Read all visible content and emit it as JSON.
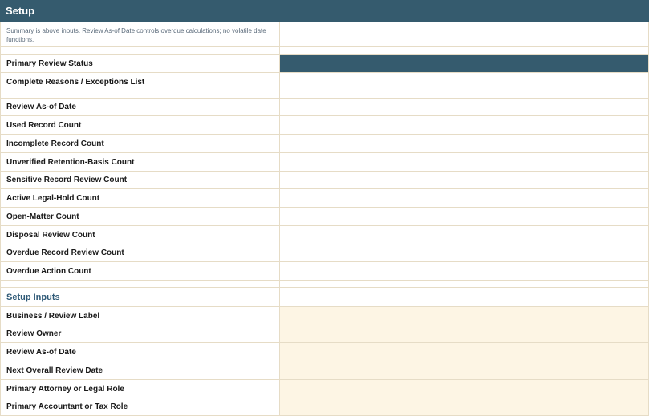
{
  "title": "Setup",
  "note": "Summary is above inputs. Review As-of Date controls overdue calculations; no volatile date functions.",
  "summary": {
    "primary_status": "Primary Review Status",
    "reasons": "Complete Reasons / Exceptions List",
    "as_of": "Review As-of Date",
    "used": "Used Record Count",
    "incomplete": "Incomplete Record Count",
    "unverified": "Unverified Retention-Basis Count",
    "sensitive": "Sensitive Record Review Count",
    "legal_hold": "Active Legal-Hold Count",
    "open_matter": "Open-Matter Count",
    "disposal": "Disposal Review Count",
    "overdue_record": "Overdue Record Review Count",
    "overdue_action": "Overdue Action Count"
  },
  "inputs": {
    "section_title": "Setup Inputs",
    "business_label": "Business / Review Label",
    "owner": "Review Owner",
    "as_of": "Review As-of Date",
    "next_review": "Next Overall Review Date",
    "attorney": "Primary Attorney or Legal Role",
    "accountant": "Primary Accountant or Tax Role"
  }
}
